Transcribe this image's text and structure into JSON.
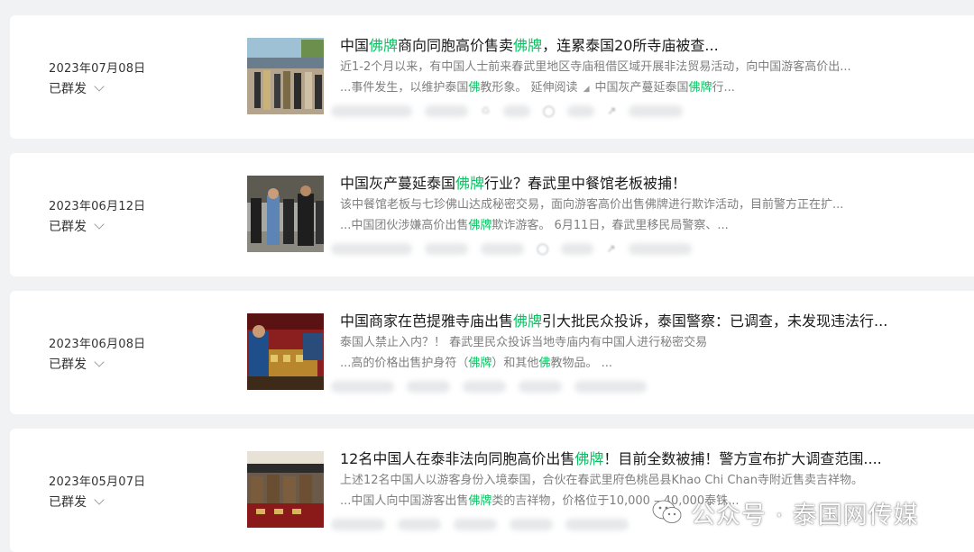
{
  "articles": [
    {
      "date": "2023年07月08日",
      "status": "已群发",
      "title_parts": [
        "中国",
        "佛牌",
        "商向同胞高价售卖",
        "佛牌",
        "，连累泰国20所寺庙被查..."
      ],
      "description": "近1-2个月以来，有中国人士前来春武里地区寺庙租借区域开展非法贸易活动，向中国游客高价出...",
      "excerpt_parts": [
        "...事件发生，以维护泰国",
        "佛",
        "教形象。 延伸阅读",
        "中国灰产蔓延泰国",
        "佛牌",
        "行..."
      ]
    },
    {
      "date": "2023年06月12日",
      "status": "已群发",
      "title_parts": [
        "中国灰产蔓延泰国",
        "佛牌",
        "行业？春武里中餐馆老板被捕！"
      ],
      "description": "该中餐馆老板与七珍佛山达成秘密交易，面向游客高价出售佛牌进行欺诈活动，目前警方正在扩...",
      "excerpt_parts": [
        "...中国团伙涉嫌高价出售",
        "佛牌",
        "欺诈游客。 6月11日，春武里移民局警察、..."
      ]
    },
    {
      "date": "2023年06月08日",
      "status": "已群发",
      "title_parts": [
        "中国商家在芭提雅寺庙出售",
        "佛牌",
        "引大批民众投诉，泰国警察：已调查，未发现违法行..."
      ],
      "description": "泰国人禁止入内？！ 春武里民众投诉当地寺庙内有中国人进行秘密交易",
      "excerpt_parts": [
        "...高的价格出售护身符（",
        "佛牌",
        "）和其他",
        "佛",
        "教物品。 ..."
      ]
    },
    {
      "date": "2023年05月07日",
      "status": "已群发",
      "title_parts": [
        "12名中国人在泰非法向同胞高价出售",
        "佛牌",
        "！目前全数被捕！警方宣布扩大调查范围...."
      ],
      "description": "上述12名中国人以游客身份入境泰国，合伙在春武里府色桃邑县Khao Chi Chan寺附近售卖吉祥物。",
      "excerpt_parts": [
        "...中国人向中国游客出售",
        "佛牌",
        "类的吉祥物，价格位于10,000 – 40,000泰铢..."
      ]
    }
  ],
  "stat_icons": [
    "like-icon",
    "comment-icon",
    "share-icon"
  ],
  "watermark": "公众号 · 泰国网传媒",
  "colors": {
    "highlight": "#07c160",
    "page_bg": "#f1f2f4",
    "card_bg": "#ffffff"
  }
}
